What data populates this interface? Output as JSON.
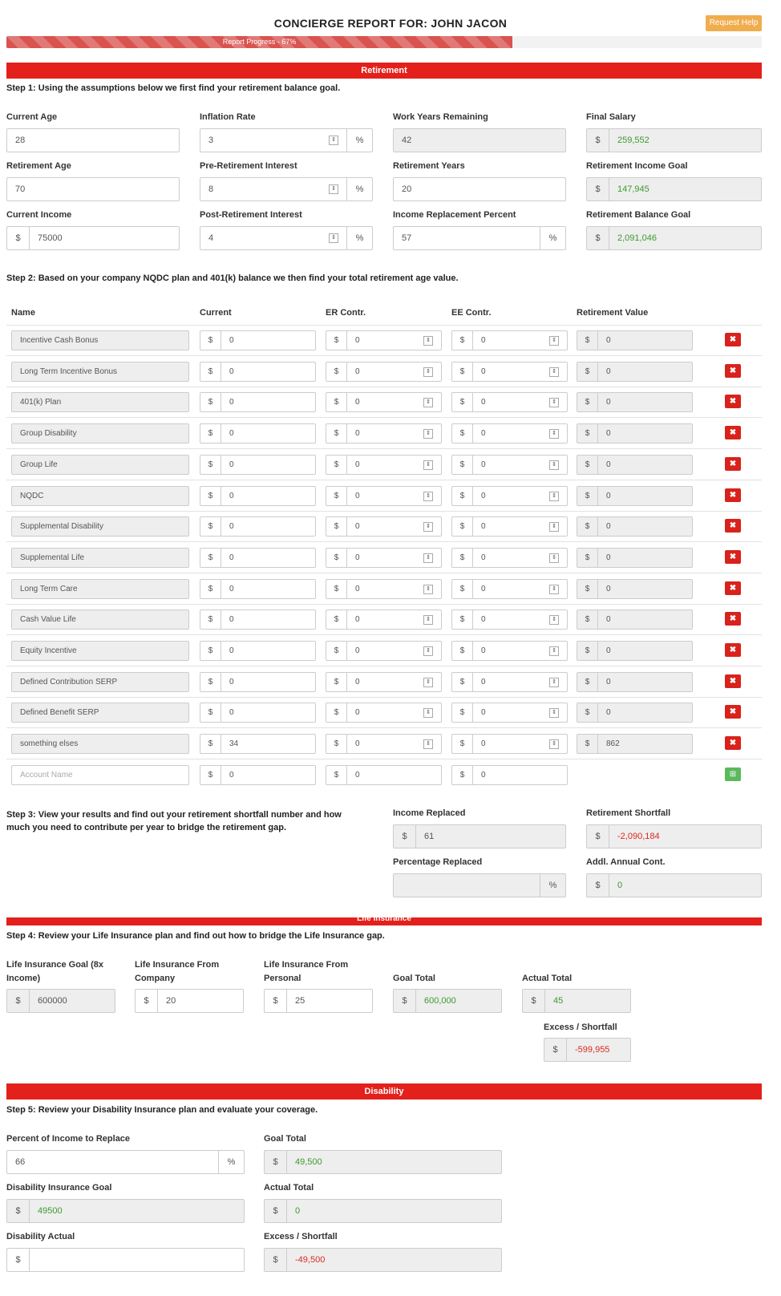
{
  "header": {
    "title": "CONCIERGE REPORT FOR: JOHN JACON",
    "help_label": "Request Help",
    "progress_label": "Report Progress - 67%",
    "progress_fraction": 0.67
  },
  "retirement": {
    "banner": "Retirement",
    "step1": "Step 1: Using the assumptions below we first find your retirement balance goal.",
    "current_age": {
      "label": "Current Age",
      "value": "28"
    },
    "inflation_rate": {
      "label": "Inflation Rate",
      "value": "3",
      "suffix": "%"
    },
    "work_years_remaining": {
      "label": "Work Years Remaining",
      "value": "42"
    },
    "final_salary": {
      "label": "Final Salary",
      "prefix": "$",
      "value": "259,552"
    },
    "retirement_age": {
      "label": "Retirement Age",
      "value": "70"
    },
    "pre_retirement_interest": {
      "label": "Pre-Retirement Interest",
      "value": "8",
      "suffix": "%"
    },
    "retirement_years": {
      "label": "Retirement Years",
      "value": "20"
    },
    "retirement_income_goal": {
      "label": "Retirement Income Goal",
      "prefix": "$",
      "value": "147,945"
    },
    "current_income": {
      "label": "Current Income",
      "prefix": "$",
      "value": "75000"
    },
    "post_retirement_interest": {
      "label": "Post-Retirement Interest",
      "value": "4",
      "suffix": "%"
    },
    "income_replacement_percent": {
      "label": "Income Replacement Percent",
      "value": "57",
      "suffix": "%"
    },
    "retirement_balance_goal": {
      "label": "Retirement Balance Goal",
      "prefix": "$",
      "value": "2,091,046"
    },
    "step2": "Step 2: Based on your company NQDC plan and 401(k) balance we then find your total retirement age value.",
    "table": {
      "headers": [
        "Name",
        "Current",
        "ER Contr.",
        "EE Contr.",
        "Retirement Value"
      ],
      "currency": "$",
      "rows": [
        {
          "name": "Incentive Cash Bonus",
          "current": "0",
          "er": "0",
          "ee": "0",
          "value": "0"
        },
        {
          "name": "Long Term Incentive Bonus",
          "current": "0",
          "er": "0",
          "ee": "0",
          "value": "0"
        },
        {
          "name": "401(k) Plan",
          "current": "0",
          "er": "0",
          "ee": "0",
          "value": "0"
        },
        {
          "name": "Group Disability",
          "current": "0",
          "er": "0",
          "ee": "0",
          "value": "0"
        },
        {
          "name": "Group Life",
          "current": "0",
          "er": "0",
          "ee": "0",
          "value": "0"
        },
        {
          "name": "NQDC",
          "current": "0",
          "er": "0",
          "ee": "0",
          "value": "0"
        },
        {
          "name": "Supplemental Disability",
          "current": "0",
          "er": "0",
          "ee": "0",
          "value": "0"
        },
        {
          "name": "Supplemental Life",
          "current": "0",
          "er": "0",
          "ee": "0",
          "value": "0"
        },
        {
          "name": "Long Term Care",
          "current": "0",
          "er": "0",
          "ee": "0",
          "value": "0"
        },
        {
          "name": "Cash Value Life",
          "current": "0",
          "er": "0",
          "ee": "0",
          "value": "0"
        },
        {
          "name": "Equity Incentive",
          "current": "0",
          "er": "0",
          "ee": "0",
          "value": "0"
        },
        {
          "name": "Defined Contribution SERP",
          "current": "0",
          "er": "0",
          "ee": "0",
          "value": "0"
        },
        {
          "name": "Defined Benefit SERP",
          "current": "0",
          "er": "0",
          "ee": "0",
          "value": "0"
        },
        {
          "name": "something elses",
          "current": "34",
          "er": "0",
          "ee": "0",
          "value": "862"
        }
      ],
      "new_row": {
        "placeholder": "Account Name",
        "current": "0",
        "er": "0",
        "ee": "0"
      }
    },
    "step3": "Step 3: View your results and find out your retirement shortfall number and how much you need to contribute per year to bridge the retirement gap.",
    "income_replaced": {
      "label": "Income Replaced",
      "prefix": "$",
      "value": "61"
    },
    "retirement_shortfall": {
      "label": "Retirement Shortfall",
      "prefix": "$",
      "value": "-2,090,184"
    },
    "percentage_replaced": {
      "label": "Percentage Replaced",
      "value": "",
      "suffix": "%"
    },
    "addl_annual_cont": {
      "label": "Addl. Annual Cont.",
      "prefix": "$",
      "value": "0"
    }
  },
  "life": {
    "banner": "Life Insurance",
    "step4": "Step 4: Review your Life Insurance plan and find out how to bridge the Life Insurance gap.",
    "goal_8x": {
      "label1": "Life Insurance Goal (8x",
      "label2": "Income)",
      "prefix": "$",
      "value": "600000"
    },
    "from_company": {
      "label1": "Life Insurance From",
      "label2": "Company",
      "prefix": "$",
      "value": "20"
    },
    "from_personal": {
      "label1": "Life Insurance From",
      "label2": "Personal",
      "prefix": "$",
      "value": "25"
    },
    "goal_total": {
      "label": "Goal Total",
      "prefix": "$",
      "value": "600,000"
    },
    "actual_total": {
      "label": "Actual Total",
      "prefix": "$",
      "value": "45"
    },
    "excess_shortfall": {
      "label": "Excess / Shortfall",
      "prefix": "$",
      "value": "-599,955"
    }
  },
  "disability": {
    "banner": "Disability",
    "step5": "Step 5: Review your Disability Insurance plan and evaluate your coverage.",
    "percent_to_replace": {
      "label": "Percent of Income to Replace",
      "value": "66",
      "suffix": "%"
    },
    "goal_total": {
      "label": "Goal Total",
      "prefix": "$",
      "value": "49,500"
    },
    "insurance_goal": {
      "label": "Disability Insurance Goal",
      "prefix": "$",
      "value": "49500"
    },
    "actual_total": {
      "label": "Actual Total",
      "prefix": "$",
      "value": "0"
    },
    "disability_actual": {
      "label": "Disability Actual",
      "prefix": "$",
      "value": ""
    },
    "excess_shortfall": {
      "label": "Excess / Shortfall",
      "prefix": "$",
      "value": "-49,500"
    }
  },
  "colors": {
    "banner": "#e3201b",
    "positive": "#3c9a2f",
    "negative": "#d92b1f",
    "help": "#f0ad4e"
  }
}
